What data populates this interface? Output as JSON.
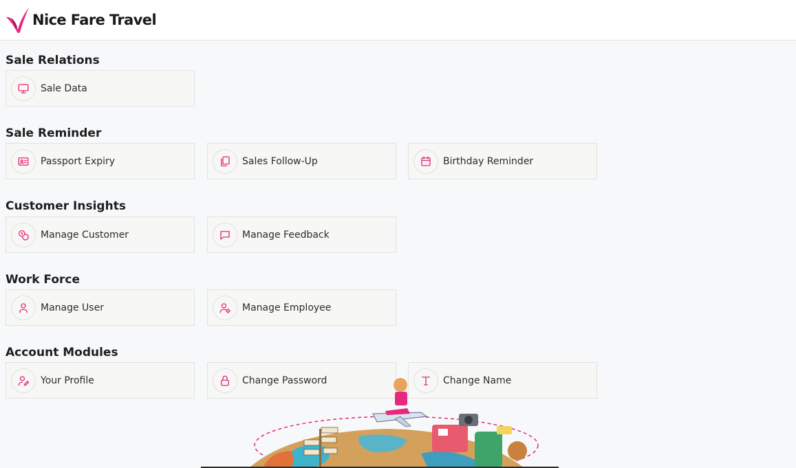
{
  "brand": {
    "name": "Nice Fare Travel",
    "accent": "#e6287e"
  },
  "sections": [
    {
      "title": "Sale Relations",
      "items": [
        {
          "label": "Sale Data",
          "icon": "monitor-icon"
        }
      ]
    },
    {
      "title": "Sale Reminder",
      "items": [
        {
          "label": "Passport Expiry",
          "icon": "id-card-icon"
        },
        {
          "label": "Sales Follow-Up",
          "icon": "copy-icon"
        },
        {
          "label": "Birthday Reminder",
          "icon": "calendar-icon"
        }
      ]
    },
    {
      "title": "Customer Insights",
      "items": [
        {
          "label": "Manage Customer",
          "icon": "coins-icon"
        },
        {
          "label": "Manage Feedback",
          "icon": "message-icon"
        }
      ]
    },
    {
      "title": "Work Force",
      "items": [
        {
          "label": "Manage User",
          "icon": "user-icon"
        },
        {
          "label": "Manage Employee",
          "icon": "user-cog-icon"
        }
      ]
    },
    {
      "title": "Account Modules",
      "items": [
        {
          "label": "Your Profile",
          "icon": "user-edit-icon"
        },
        {
          "label": "Change Password",
          "icon": "lock-icon"
        },
        {
          "label": "Change Name",
          "icon": "type-icon"
        }
      ]
    }
  ]
}
